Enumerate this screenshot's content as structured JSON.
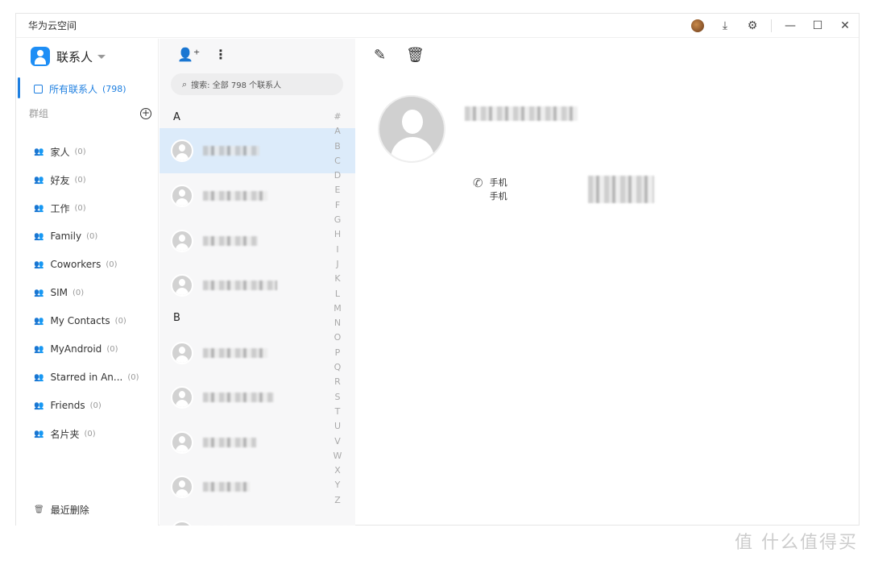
{
  "window": {
    "title": "华为云空间",
    "icons": [
      "avatar",
      "download-icon",
      "gear-icon",
      "minimize-icon",
      "maximize-icon",
      "close-icon"
    ]
  },
  "sidebar": {
    "app_name": "联系人",
    "all_contacts": {
      "label": "所有联系人",
      "count": "(798)"
    },
    "groups_header": "群组",
    "groups": [
      {
        "label": "家人",
        "count": "(0)"
      },
      {
        "label": "好友",
        "count": "(0)"
      },
      {
        "label": "工作",
        "count": "(0)"
      },
      {
        "label": "Family",
        "count": "(0)"
      },
      {
        "label": "Coworkers",
        "count": "(0)"
      },
      {
        "label": "SIM",
        "count": "(0)"
      },
      {
        "label": "My Contacts",
        "count": "(0)"
      },
      {
        "label": "MyAndroid",
        "count": "(0)"
      },
      {
        "label": "Starred in An...",
        "count": "(0)"
      },
      {
        "label": "Friends",
        "count": "(0)"
      },
      {
        "label": "名片夹",
        "count": "(0)"
      }
    ],
    "recently_deleted": "最近删除"
  },
  "list": {
    "search_placeholder": "搜索: 全部 798 个联系人",
    "sections": [
      "A",
      "B"
    ],
    "index": [
      "#",
      "A",
      "B",
      "C",
      "D",
      "E",
      "F",
      "G",
      "H",
      "I",
      "J",
      "K",
      "L",
      "M",
      "N",
      "O",
      "P",
      "Q",
      "R",
      "S",
      "T",
      "U",
      "V",
      "W",
      "X",
      "Y",
      "Z"
    ]
  },
  "detail": {
    "phone_labels": [
      "手机",
      "手机"
    ]
  },
  "watermark": "值 什么值得买",
  "colors": {
    "accent": "#1e7fe0",
    "selected_row": "#dcebfa"
  }
}
